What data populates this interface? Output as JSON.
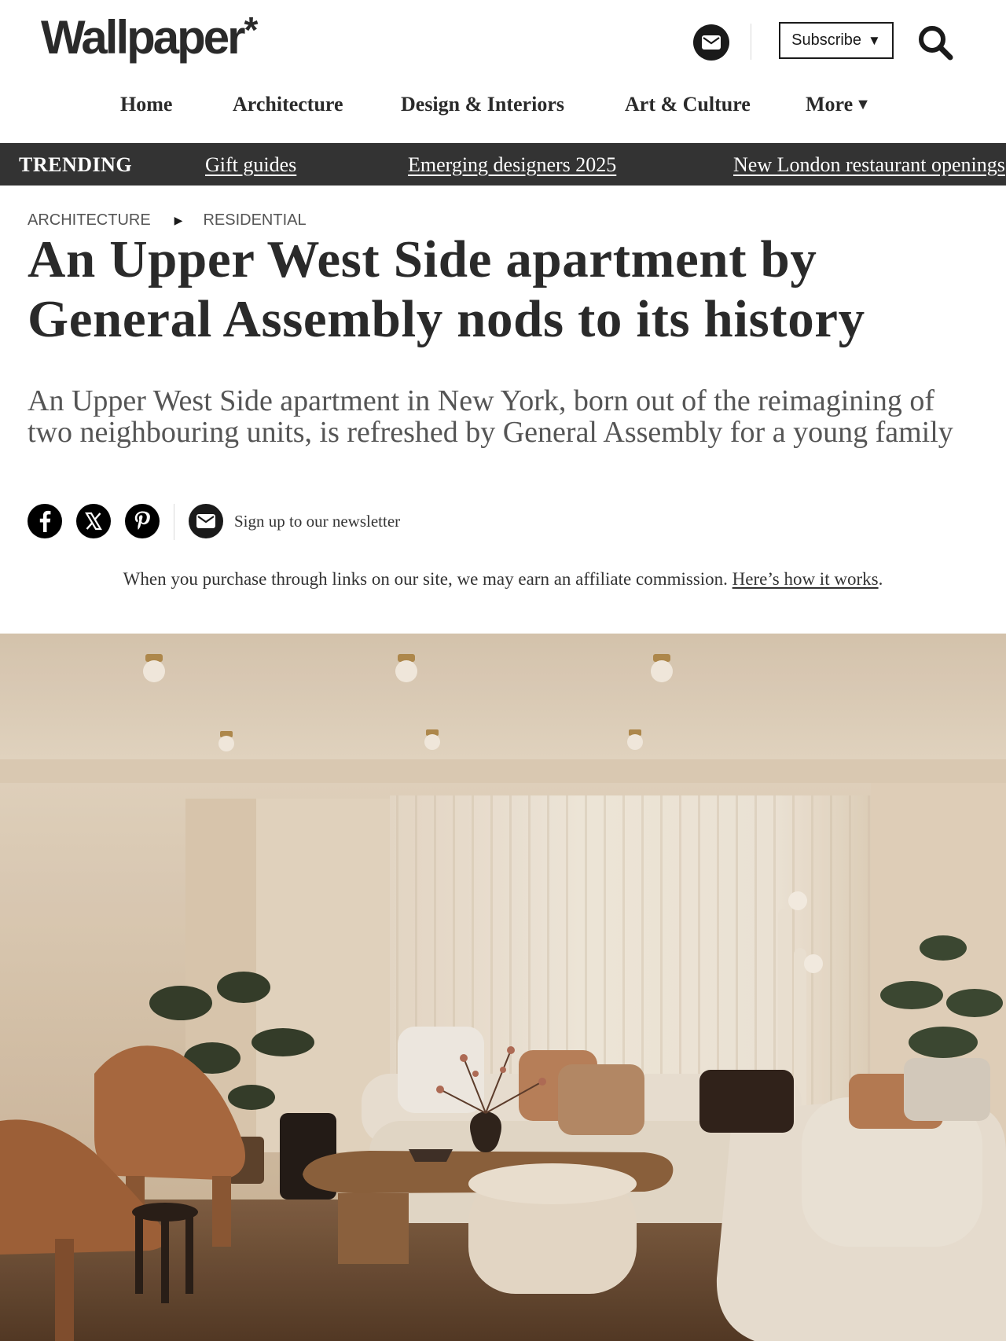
{
  "site": {
    "logo_text": "Wallpaper",
    "logo_mark": "*"
  },
  "header": {
    "subscribe_label": "Subscribe",
    "subscribe_caret": "▼"
  },
  "nav": {
    "items": [
      {
        "label": "Home"
      },
      {
        "label": "Architecture"
      },
      {
        "label": "Design & Interiors"
      },
      {
        "label": "Art & Culture"
      },
      {
        "label": "More",
        "caret": "▼"
      }
    ]
  },
  "trending": {
    "label": "TRENDING",
    "links": [
      "Gift guides",
      "Emerging designers 2025",
      "New London restaurant openings"
    ]
  },
  "breadcrumb": {
    "section": "ARCHITECTURE",
    "separator": "▶",
    "subsection": "RESIDENTIAL"
  },
  "article": {
    "title": "An Upper West Side apartment by General Assembly nods to its history",
    "standfirst": "An Upper West Side apartment in New York, born out of the reimagining of two neighbouring units, is refreshed by General Assembly for a young family"
  },
  "share": {
    "icons": [
      "facebook-icon",
      "x-icon",
      "pinterest-icon",
      "mail-icon"
    ],
    "newsletter_label": "Sign up to our newsletter"
  },
  "affiliate": {
    "text": "When you purchase through links on our site, we may earn an affiliate commission.",
    "link_text": "Here’s how it works",
    "trailing": "."
  },
  "colors": {
    "text": "#2a2a2a",
    "trending_bg": "#333333",
    "icon_bg": "#000000",
    "muted_text": "#555555"
  }
}
